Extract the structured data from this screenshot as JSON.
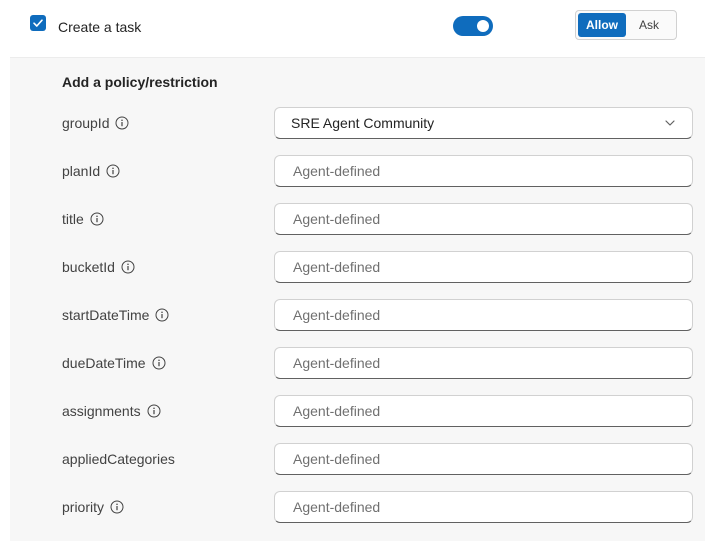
{
  "header": {
    "checkbox_checked": true,
    "task_label": "Create a task",
    "toggle_on": true,
    "mode": {
      "allow_label": "Allow",
      "ask_label": "Ask",
      "selected": "Allow"
    }
  },
  "panel": {
    "title": "Add a policy/restriction",
    "fields": [
      {
        "name": "groupId",
        "type": "select",
        "value": "SRE Agent Community",
        "info": true
      },
      {
        "name": "planId",
        "type": "text",
        "placeholder": "Agent-defined",
        "info": true
      },
      {
        "name": "title",
        "type": "text",
        "placeholder": "Agent-defined",
        "info": true
      },
      {
        "name": "bucketId",
        "type": "text",
        "placeholder": "Agent-defined",
        "info": true
      },
      {
        "name": "startDateTime",
        "type": "text",
        "placeholder": "Agent-defined",
        "info": true
      },
      {
        "name": "dueDateTime",
        "type": "text",
        "placeholder": "Agent-defined",
        "info": true
      },
      {
        "name": "assignments",
        "type": "text",
        "placeholder": "Agent-defined",
        "info": true
      },
      {
        "name": "appliedCategories",
        "type": "text",
        "placeholder": "Agent-defined",
        "info": false
      },
      {
        "name": "priority",
        "type": "text",
        "placeholder": "Agent-defined",
        "info": true
      }
    ]
  },
  "colors": {
    "accent": "#0f6cbd",
    "panel_bg": "#f7f7f7"
  },
  "icons": {
    "checkbox": "checkmark-icon",
    "info": "info-icon",
    "dropdown": "chevron-down-icon"
  }
}
